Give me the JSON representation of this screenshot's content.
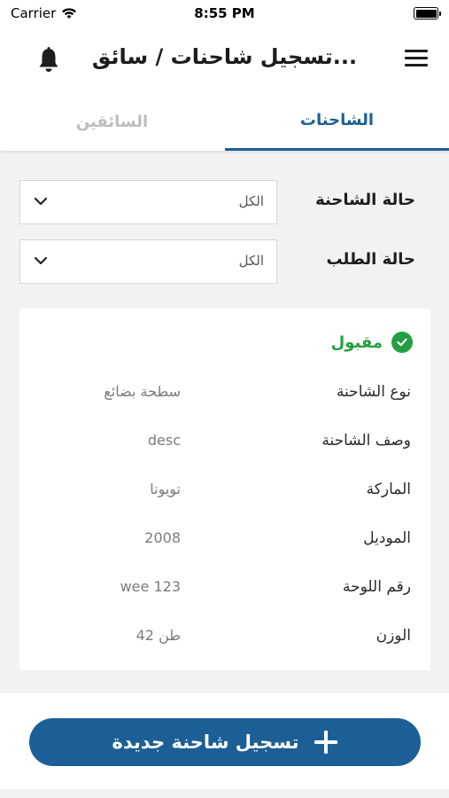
{
  "status_bar": {
    "carrier": "Carrier",
    "time": "8:55 PM"
  },
  "header": {
    "title": "تسجيل شاحنات / سائق..."
  },
  "tabs": [
    {
      "label": "الشاحنات",
      "active": true
    },
    {
      "label": "السائقين",
      "active": false
    }
  ],
  "filters": {
    "truck_status": {
      "label": "حالة الشاحنة",
      "value": "الكل"
    },
    "request_status": {
      "label": "حالة الطلب",
      "value": "الكل"
    }
  },
  "truck_card": {
    "status": "مقبول",
    "status_color": "#22a041",
    "rows": [
      {
        "label": "نوع الشاحنة",
        "value": "سطحة بضائع"
      },
      {
        "label": "وصف الشاحنة",
        "value": "desc"
      },
      {
        "label": "الماركة",
        "value": "تويوتا"
      },
      {
        "label": "الموديل",
        "value": "2008"
      },
      {
        "label": "رقم اللوحة",
        "value": "wee 123"
      },
      {
        "label": "الوزن",
        "value": "42 طن"
      }
    ]
  },
  "add_button": {
    "label": "تسجيل شاحنة جديدة"
  },
  "colors": {
    "accent": "#1c5f96",
    "success": "#22a041"
  },
  "icons": {
    "bell": "bell-icon",
    "menu": "hamburger-menu-icon",
    "check": "check-circle-icon",
    "chevron": "chevron-down-icon",
    "plus": "plus-icon"
  }
}
